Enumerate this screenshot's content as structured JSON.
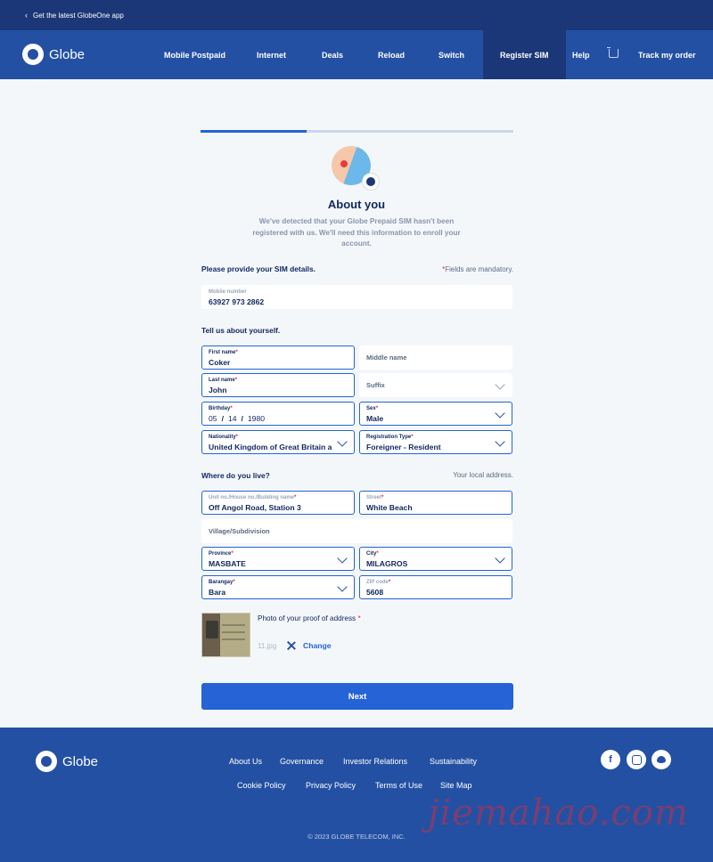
{
  "topbar": {
    "app_link": "Get the latest GlobeOne app"
  },
  "brand": {
    "name": "Globe"
  },
  "nav": {
    "items": [
      {
        "label": "Mobile Postpaid"
      },
      {
        "label": "Internet"
      },
      {
        "label": "Deals"
      },
      {
        "label": "Reload"
      },
      {
        "label": "Switch"
      },
      {
        "label": "Register SIM",
        "active": true
      },
      {
        "label": "Help"
      }
    ],
    "cart_icon": "cart-icon",
    "track_order": "Track my order"
  },
  "progress": {
    "fraction": 0.34
  },
  "hero": {
    "title": "About you",
    "subtitle": "We've detected that your Globe Prepaid SIM hasn't been registered with us. We'll need this information to enroll your account."
  },
  "sim_section": {
    "heading": "Please provide your SIM details.",
    "mandatory_note": "Fields are mandatory.",
    "mobile": {
      "label": "Mobile number",
      "value": "63927 973 2862"
    }
  },
  "personal_section": {
    "heading": "Tell us about yourself.",
    "first_name": {
      "label": "First name",
      "value": "Coker"
    },
    "middle_name": {
      "placeholder": "Middle name"
    },
    "last_name": {
      "label": "Last name",
      "value": "John"
    },
    "suffix": {
      "placeholder": "Suffix"
    },
    "birthday": {
      "label": "Birthday",
      "month": "05",
      "day": "14",
      "year": "1980",
      "separator": "/"
    },
    "sex": {
      "label": "Sex",
      "value": "Male"
    },
    "nationality": {
      "label": "Nationality",
      "value": "United Kingdom of Great Britain a"
    },
    "registration_type": {
      "label": "Registration Type",
      "value": "Foreigner - Resident"
    }
  },
  "address_section": {
    "heading": "Where do you live?",
    "note": "Your local address.",
    "unit": {
      "label": "Unit no./House no./Building name",
      "value": "Off Angol Road, Station 3"
    },
    "street": {
      "label": "Street",
      "value": "White Beach"
    },
    "village": {
      "placeholder": "Village/Subdivision"
    },
    "province": {
      "label": "Province",
      "value": "MASBATE"
    },
    "city": {
      "label": "City",
      "value": "MILAGROS"
    },
    "barangay": {
      "label": "Barangay",
      "value": "Bara"
    },
    "zip": {
      "label": "ZIP code",
      "value": "5608"
    }
  },
  "proof": {
    "label": "Photo of your proof of address",
    "file_name": "11.jpg",
    "remove_icon": "close-icon",
    "change_label": "Change"
  },
  "next_button": "Next",
  "footer": {
    "links_row1": [
      "About Us",
      "Governance",
      "Investor Relations",
      "Sustainability"
    ],
    "links_row2": [
      "Cookie Policy",
      "Privacy Policy",
      "Terms of Use",
      "Site Map"
    ],
    "social": [
      "facebook-icon",
      "instagram-icon",
      "twitter-icon"
    ],
    "copyright": "© 2023 GLOBE TELECOM, INC."
  },
  "watermark": "jiemahao.com",
  "colors": {
    "primary": "#2563d6",
    "navy": "#1b3777",
    "nav_blue": "#2350a3",
    "required": "#e3253d"
  }
}
